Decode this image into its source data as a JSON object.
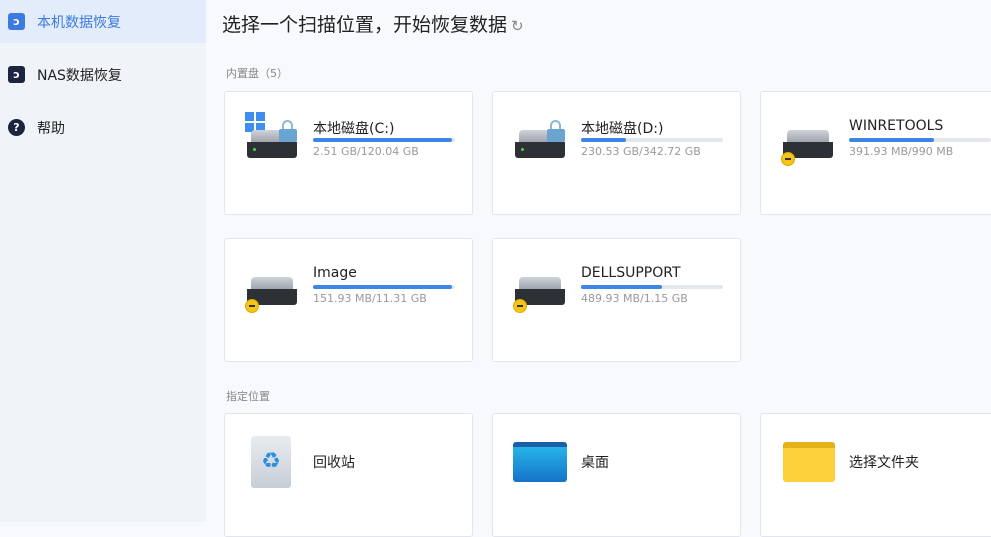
{
  "sidebar": {
    "items": [
      {
        "label": "本机数据恢复",
        "active": true
      },
      {
        "label": "NAS数据恢复"
      },
      {
        "label": "帮助"
      }
    ]
  },
  "header": {
    "title": "选择一个扫描位置，开始恢复数据",
    "refresh_icon": "↻"
  },
  "internal": {
    "label": "内置盘（5）",
    "drives": [
      {
        "name": "本地磁盘(C:)",
        "size": "2.51 GB/120.04 GB",
        "used_pct": 98
      },
      {
        "name": "本地磁盘(D:)",
        "size": "230.53 GB/342.72 GB",
        "used_pct": 32
      },
      {
        "name": "WINRETOOLS",
        "size": "391.93 MB/990 MB",
        "used_pct": 60
      },
      {
        "name": "Image",
        "size": "151.93 MB/11.31 GB",
        "used_pct": 98
      },
      {
        "name": "DELLSUPPORT",
        "size": "489.93 MB/1.15 GB",
        "used_pct": 57
      }
    ]
  },
  "locations": {
    "label": "指定位置",
    "items": [
      {
        "name": "回收站"
      },
      {
        "name": "桌面"
      },
      {
        "name": "选择文件夹"
      }
    ]
  }
}
